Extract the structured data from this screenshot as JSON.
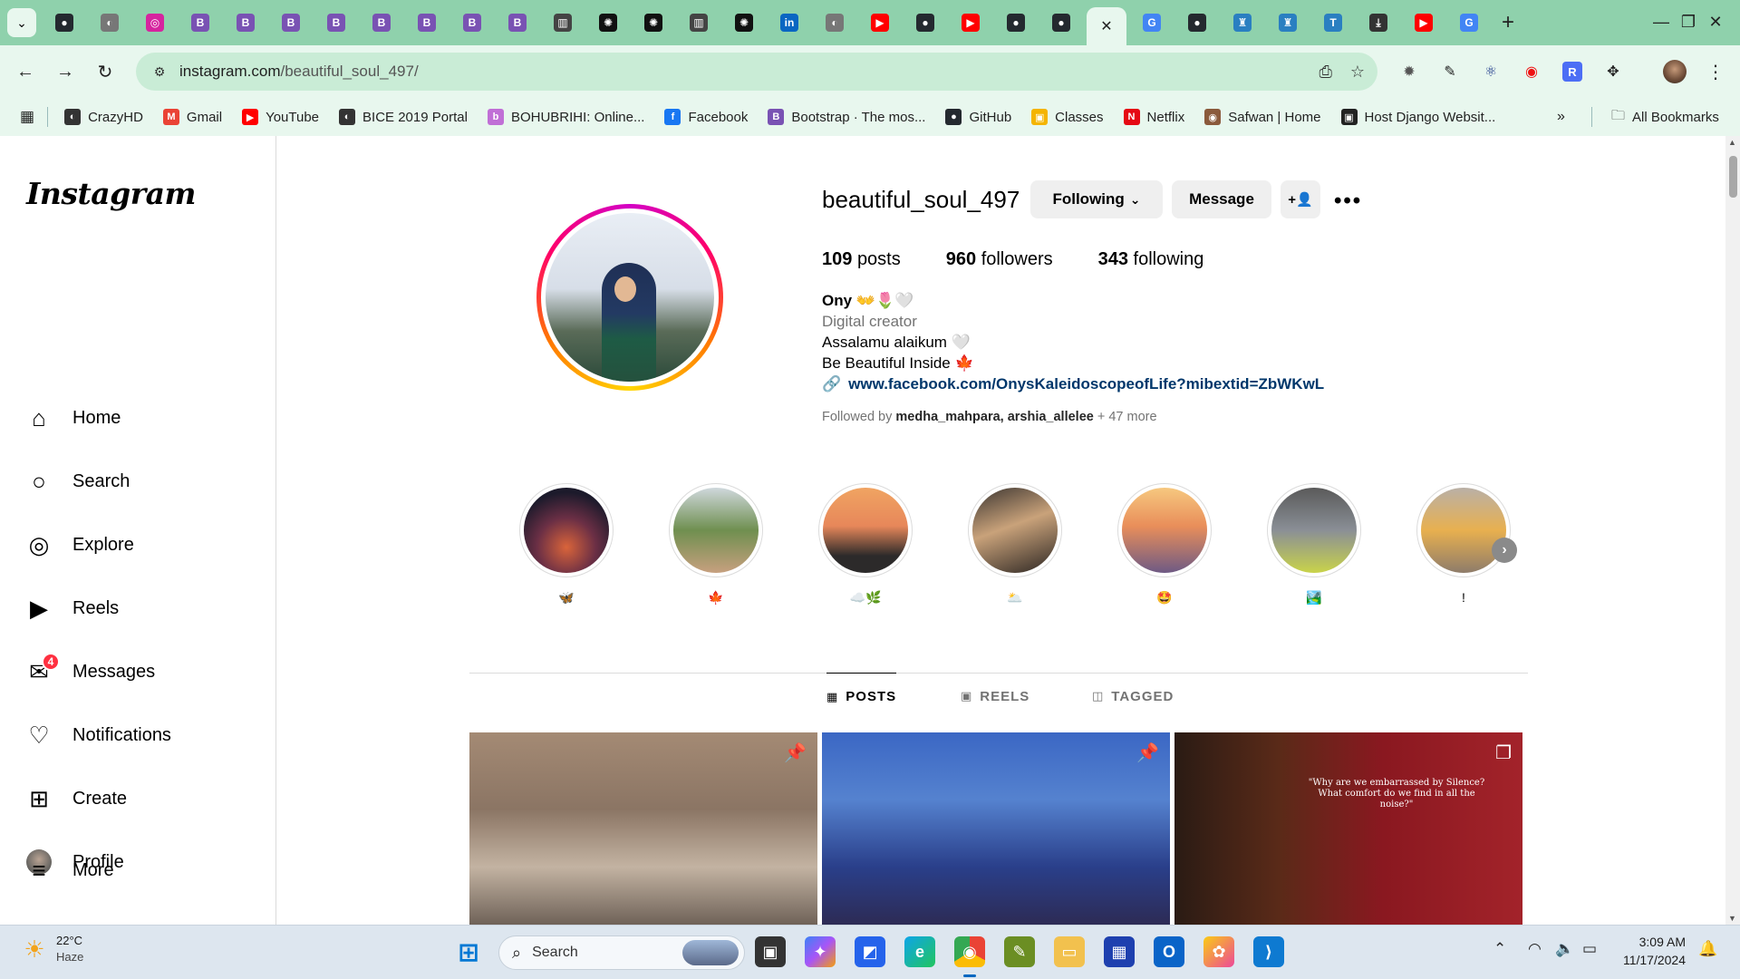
{
  "browser": {
    "tabs": [
      {
        "icon": "github-icon",
        "color": "#24292f",
        "glyph": "●"
      },
      {
        "icon": "globe-icon",
        "color": "#777777",
        "glyph": "◐"
      },
      {
        "icon": "instagram-icon",
        "color": "#d6249f",
        "glyph": "◎"
      },
      {
        "icon": "bootstrap-icon",
        "color": "#7952b3",
        "glyph": "B"
      },
      {
        "icon": "bootstrap-icon",
        "color": "#7952b3",
        "glyph": "B"
      },
      {
        "icon": "bootstrap-icon",
        "color": "#7952b3",
        "glyph": "B"
      },
      {
        "icon": "bootstrap-icon",
        "color": "#7952b3",
        "glyph": "B"
      },
      {
        "icon": "bootstrap-icon",
        "color": "#7952b3",
        "glyph": "B"
      },
      {
        "icon": "bootstrap-icon",
        "color": "#7952b3",
        "glyph": "B"
      },
      {
        "icon": "bootstrap-icon",
        "color": "#7952b3",
        "glyph": "B"
      },
      {
        "icon": "bootstrap-icon",
        "color": "#7952b3",
        "glyph": "B"
      },
      {
        "icon": "reader-icon",
        "color": "#444444",
        "glyph": "▥"
      },
      {
        "icon": "openai-icon",
        "color": "#111111",
        "glyph": "✺"
      },
      {
        "icon": "openai-icon",
        "color": "#111111",
        "glyph": "✺"
      },
      {
        "icon": "reader-icon",
        "color": "#444444",
        "glyph": "▥"
      },
      {
        "icon": "openai-icon",
        "color": "#111111",
        "glyph": "✺"
      },
      {
        "icon": "linkedin-icon",
        "color": "#0a66c2",
        "glyph": "in"
      },
      {
        "icon": "globe-icon",
        "color": "#777777",
        "glyph": "◐"
      },
      {
        "icon": "youtube-icon",
        "color": "#ff0000",
        "glyph": "▶"
      },
      {
        "icon": "github-icon",
        "color": "#24292f",
        "glyph": "●"
      },
      {
        "icon": "youtube-icon",
        "color": "#ff0000",
        "glyph": "▶"
      },
      {
        "icon": "github-icon",
        "color": "#24292f",
        "glyph": "●"
      },
      {
        "icon": "github-icon",
        "color": "#24292f",
        "glyph": "●"
      }
    ],
    "active_tab_icon": "close-icon",
    "tabs_after": [
      {
        "icon": "google-icon",
        "color": "#4285f4",
        "glyph": "G"
      },
      {
        "icon": "github-icon",
        "color": "#24292f",
        "glyph": "●"
      },
      {
        "icon": "django-icon",
        "color": "#2a7fc1",
        "glyph": "♜"
      },
      {
        "icon": "django-icon",
        "color": "#2a7fc1",
        "glyph": "♜"
      },
      {
        "icon": "trello-icon",
        "color": "#2a7fc1",
        "glyph": "T"
      },
      {
        "icon": "download-icon",
        "color": "#333333",
        "glyph": "⤓"
      },
      {
        "icon": "youtube-icon",
        "color": "#ff0000",
        "glyph": "▶"
      },
      {
        "icon": "google-icon",
        "color": "#4285f4",
        "glyph": "G"
      }
    ],
    "url_host": "instagram.com",
    "url_path": "/beautiful_soul_497/",
    "bookmarks": [
      {
        "label": "CrazyHD",
        "color": "#333333",
        "glyph": "◐"
      },
      {
        "label": "Gmail",
        "color": "#ea4335",
        "glyph": "M"
      },
      {
        "label": "YouTube",
        "color": "#ff0000",
        "glyph": "▶"
      },
      {
        "label": "BICE 2019 Portal",
        "color": "#333333",
        "glyph": "◐"
      },
      {
        "label": "BOHUBRIHI: Online...",
        "color": "#c06fd6",
        "glyph": "b"
      },
      {
        "label": "Facebook",
        "color": "#1877f2",
        "glyph": "f"
      },
      {
        "label": "Bootstrap · The mos...",
        "color": "#7952b3",
        "glyph": "B"
      },
      {
        "label": "GitHub",
        "color": "#24292f",
        "glyph": "●"
      },
      {
        "label": "Classes",
        "color": "#f4b400",
        "glyph": "▣"
      },
      {
        "label": "Netflix",
        "color": "#e50914",
        "glyph": "N"
      },
      {
        "label": "Safwan | Home",
        "color": "#8a5a3c",
        "glyph": "◉"
      },
      {
        "label": "Host Django Websit...",
        "color": "#222222",
        "glyph": "▣"
      }
    ],
    "all_bookmarks": "All Bookmarks"
  },
  "sidebar": {
    "logo": "Instagram",
    "items": [
      {
        "label": "Home",
        "icon": "home-icon",
        "glyph": "⌂"
      },
      {
        "label": "Search",
        "icon": "search-icon",
        "glyph": "○"
      },
      {
        "label": "Explore",
        "icon": "compass-icon",
        "glyph": "◎"
      },
      {
        "label": "Reels",
        "icon": "reels-icon",
        "glyph": "▶"
      },
      {
        "label": "Messages",
        "icon": "messenger-icon",
        "glyph": "✉",
        "badge": "4"
      },
      {
        "label": "Notifications",
        "icon": "heart-icon",
        "glyph": "♡"
      },
      {
        "label": "Create",
        "icon": "plus-square-icon",
        "glyph": "⊞"
      },
      {
        "label": "Profile",
        "icon": "profile-avatar",
        "glyph": "●"
      }
    ],
    "more": "More"
  },
  "profile": {
    "username": "beautiful_soul_497",
    "following_btn": "Following",
    "message_btn": "Message",
    "posts_count": "109",
    "posts_label": "posts",
    "followers_count": "960",
    "followers_label": "followers",
    "following_count": "343",
    "following_label": "following",
    "name": "Ony",
    "name_emoji": "👐🌷🤍",
    "category": "Digital creator",
    "bio_line1": "Assalamu alaikum 🤍",
    "bio_line2": "Be Beautiful Inside 🍁",
    "link": "www.facebook.com/OnysKaleidoscopeofLife?mibextid=ZbWKwL",
    "followed_prefix": "Followed by",
    "followed_names": "medha_mahpara, arshia_allelee",
    "followed_more": "+ 47 more"
  },
  "highlights": [
    {
      "caption": "🦋",
      "bg": "radial-gradient(circle at 50% 70%, #d9643a 0%, #6b2f45 40%, #1c1a2b 75%)"
    },
    {
      "caption": "🍁",
      "bg": "linear-gradient(180deg,#cfd8dc 0%,#6f8f4f 50%,#c7a07f 100%)"
    },
    {
      "caption": "☁️🌿",
      "bg": "linear-gradient(180deg,#f0a462 0%,#e7875a 45%,#2c2a2a 80%)"
    },
    {
      "caption": "🌥️",
      "bg": "linear-gradient(160deg,#3a3430 0%,#c9a27a 45%,#2b2522 100%)"
    },
    {
      "caption": "🤩",
      "bg": "linear-gradient(180deg,#f6c87f 0%,#e98e5a 45%,#6e5a84 100%)"
    },
    {
      "caption": "🏞️",
      "bg": "linear-gradient(180deg,#5a5a5a 0%,#8a8f96 50%,#c9d34a 100%)"
    },
    {
      "caption": "!",
      "bg": "linear-gradient(180deg,#b9b0a6 0%,#e8b04f 50%,#8e7c6a 100%)"
    }
  ],
  "tabs": [
    {
      "label": "POSTS",
      "icon": "grid-icon",
      "glyph": "▦"
    },
    {
      "label": "REELS",
      "icon": "reels-icon",
      "glyph": "▣"
    },
    {
      "label": "TAGGED",
      "icon": "tagged-icon",
      "glyph": "◫"
    }
  ],
  "posts": [
    {
      "bg": "linear-gradient(180deg,#a48a74 0%,#8b7564 40%,#c3b3a2 70%,#6f6258 100%)",
      "badge": "pin-icon"
    },
    {
      "bg": "linear-gradient(180deg,#3b67c4 0%,#5582cf 35%,#2a3f8a 70%,#2d2b55 100%)",
      "badge": "pin-icon"
    },
    {
      "bg": "linear-gradient(90deg,#2a1b14 0%,#5a2a18 30%,#8a1820 60%,#a3232a 100%)",
      "badge": "carousel-icon",
      "quote": "\"Why are we embarrassed by Silence? What comfort do we find in all the noise?\""
    }
  ],
  "taskbar": {
    "temp": "22°C",
    "weather": "Haze",
    "search": "Search",
    "time": "3:09 AM",
    "date": "11/17/2024"
  }
}
